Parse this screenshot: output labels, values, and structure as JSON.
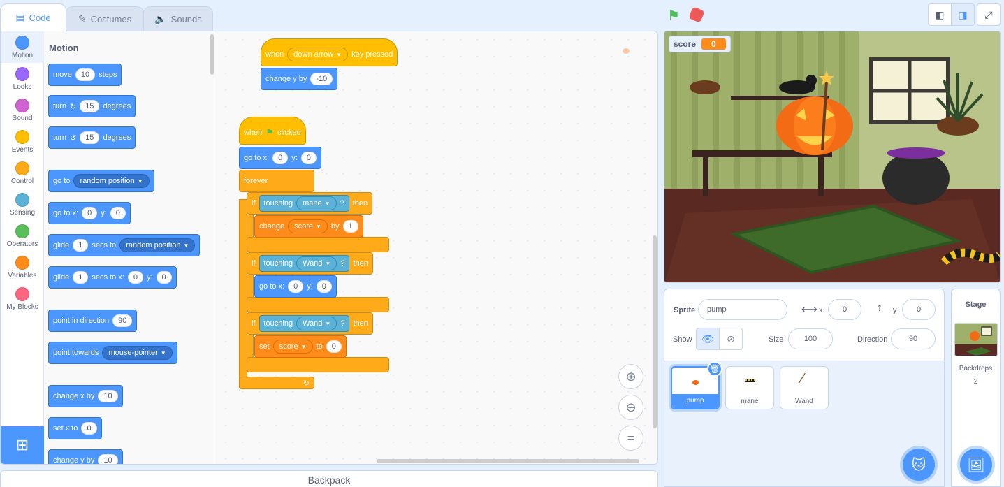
{
  "tabs": [
    {
      "label": "Code",
      "icon": "code-icon"
    },
    {
      "label": "Costumes",
      "icon": "brush-icon"
    },
    {
      "label": "Sounds",
      "icon": "speaker-icon"
    }
  ],
  "categories": [
    {
      "label": "Motion",
      "color": "#4c97ff"
    },
    {
      "label": "Looks",
      "color": "#9966ff"
    },
    {
      "label": "Sound",
      "color": "#cf63cf"
    },
    {
      "label": "Events",
      "color": "#ffbf00"
    },
    {
      "label": "Control",
      "color": "#ffab19"
    },
    {
      "label": "Sensing",
      "color": "#5cb1d6"
    },
    {
      "label": "Operators",
      "color": "#59c059"
    },
    {
      "label": "Variables",
      "color": "#ff8c1a"
    },
    {
      "label": "My Blocks",
      "color": "#ff6680"
    }
  ],
  "palette": {
    "title": "Motion",
    "move": {
      "a": "move",
      "n": "10",
      "b": "steps"
    },
    "turn_right": {
      "a": "turn",
      "n": "15",
      "b": "degrees"
    },
    "turn_left": {
      "a": "turn",
      "n": "15",
      "b": "degrees"
    },
    "goto": {
      "a": "go to",
      "dd": "random position"
    },
    "goto_xy": {
      "a": "go to x:",
      "x": "0",
      "b": "y:",
      "y": "0"
    },
    "glide": {
      "a": "glide",
      "n": "1",
      "b": "secs to",
      "dd": "random position"
    },
    "glide_xy": {
      "a": "glide",
      "n": "1",
      "b": "secs to x:",
      "x": "0",
      "c": "y:",
      "y": "0"
    },
    "point_dir": {
      "a": "point in direction",
      "n": "90"
    },
    "point_towards": {
      "a": "point towards",
      "dd": "mouse-pointer"
    },
    "change_x": {
      "a": "change x by",
      "n": "10"
    },
    "set_x": {
      "a": "set x to",
      "n": "0"
    },
    "change_y": {
      "a": "change y by",
      "n": "10"
    }
  },
  "script1": {
    "hat": {
      "a": "when",
      "dd": "down arrow",
      "b": "key pressed"
    },
    "change_y": {
      "a": "change y by",
      "n": "-10"
    }
  },
  "script2": {
    "hat": {
      "a": "when",
      "b": "clicked"
    },
    "goto": {
      "a": "go to x:",
      "x": "0",
      "b": "y:",
      "y": "0"
    },
    "forever": "forever",
    "if1": {
      "if": "if",
      "touching": "touching",
      "dd": "mane",
      "q": "?",
      "then": "then"
    },
    "change": {
      "a": "change",
      "dd": "score",
      "b": "by",
      "n": "1"
    },
    "if2": {
      "if": "if",
      "touching": "touching",
      "dd": "Wand",
      "q": "?",
      "then": "then"
    },
    "goto2": {
      "a": "go to x:",
      "x": "0",
      "b": "y:",
      "y": "0"
    },
    "if3": {
      "if": "if",
      "touching": "touching",
      "dd": "Wand",
      "q": "?",
      "then": "then"
    },
    "set": {
      "a": "set",
      "dd": "score",
      "b": "to",
      "n": "0"
    }
  },
  "backpack": "Backpack",
  "monitor": {
    "label": "score",
    "value": "0"
  },
  "sprite_info": {
    "sprite_label": "Sprite",
    "sprite_name": "pump",
    "x_label": "x",
    "x": "0",
    "y_label": "y",
    "y": "0",
    "show_label": "Show",
    "size_label": "Size",
    "size": "100",
    "direction_label": "Direction",
    "direction": "90"
  },
  "sprites": [
    {
      "name": "pump",
      "selected": true
    },
    {
      "name": "mane",
      "selected": false
    },
    {
      "name": "Wand",
      "selected": false
    }
  ],
  "stage_panel": {
    "title": "Stage",
    "backdrops_label": "Backdrops",
    "backdrops_count": "2"
  }
}
